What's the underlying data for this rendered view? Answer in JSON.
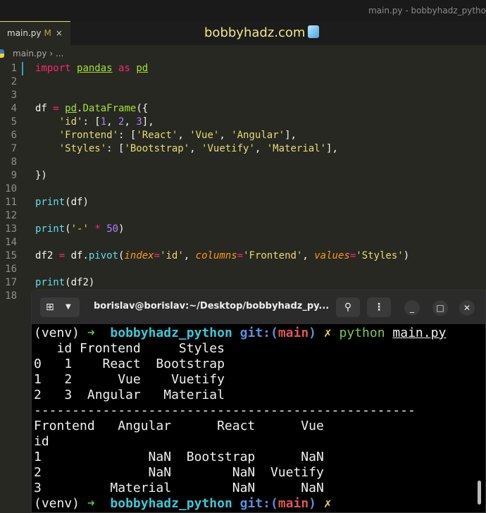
{
  "window_title": "main.py - bobbyhadz_pytho",
  "tab": {
    "label": "main.py",
    "modified": "M",
    "close": "×"
  },
  "brand": "bobbyhadz.com",
  "breadcrumb": {
    "file": "main.py",
    "sep": "›",
    "rest": "..."
  },
  "code": [
    [
      [
        "import",
        "k"
      ],
      [
        " ",
        ""
      ],
      [
        "pandas",
        "f u"
      ],
      [
        " ",
        ""
      ],
      [
        "as",
        "k"
      ],
      [
        " ",
        ""
      ],
      [
        "pd",
        "f u"
      ]
    ],
    [],
    [],
    [
      [
        "df ",
        ""
      ],
      [
        "=",
        "k"
      ],
      [
        " ",
        ""
      ],
      [
        "pd",
        "f u"
      ],
      [
        ".",
        ""
      ],
      [
        "DataFrame",
        "f"
      ],
      [
        "({",
        ""
      ]
    ],
    [
      [
        "    ",
        ""
      ],
      [
        "'id'",
        "s"
      ],
      [
        ": [",
        ""
      ],
      [
        "1",
        "n"
      ],
      [
        ", ",
        ""
      ],
      [
        "2",
        "n"
      ],
      [
        ", ",
        ""
      ],
      [
        "3",
        "n"
      ],
      [
        "],",
        ""
      ]
    ],
    [
      [
        "    ",
        ""
      ],
      [
        "'Frontend'",
        "s"
      ],
      [
        ": [",
        ""
      ],
      [
        "'React'",
        "s"
      ],
      [
        ", ",
        ""
      ],
      [
        "'Vue'",
        "s"
      ],
      [
        ", ",
        ""
      ],
      [
        "'Angular'",
        "s"
      ],
      [
        "],",
        ""
      ]
    ],
    [
      [
        "    ",
        ""
      ],
      [
        "'Styles'",
        "s"
      ],
      [
        ": [",
        ""
      ],
      [
        "'Bootstrap'",
        "s"
      ],
      [
        ", ",
        ""
      ],
      [
        "'Vuetify'",
        "s"
      ],
      [
        ", ",
        ""
      ],
      [
        "'Material'",
        "s"
      ],
      [
        "],",
        ""
      ]
    ],
    [],
    [
      [
        "})",
        ""
      ]
    ],
    [],
    [
      [
        "print",
        "b"
      ],
      [
        "(df)",
        ""
      ]
    ],
    [],
    [
      [
        "print",
        "b"
      ],
      [
        "(",
        ""
      ],
      [
        "'-'",
        "s"
      ],
      [
        " ",
        ""
      ],
      [
        "*",
        "k"
      ],
      [
        " ",
        ""
      ],
      [
        "50",
        "n"
      ],
      [
        ")",
        ""
      ]
    ],
    [],
    [
      [
        "df2 ",
        ""
      ],
      [
        "=",
        "k"
      ],
      [
        " df.",
        ""
      ],
      [
        "pivot",
        "b"
      ],
      [
        "(",
        ""
      ],
      [
        "index",
        "p"
      ],
      [
        "=",
        "k"
      ],
      [
        "'id'",
        "s"
      ],
      [
        ", ",
        ""
      ],
      [
        "columns",
        "p"
      ],
      [
        "=",
        "k"
      ],
      [
        "'Frontend'",
        "s"
      ],
      [
        ", ",
        ""
      ],
      [
        "values",
        "p"
      ],
      [
        "=",
        "k"
      ],
      [
        "'Styles'",
        "s"
      ],
      [
        ")",
        ""
      ]
    ],
    [],
    [
      [
        "print",
        "b"
      ],
      [
        "(df2)",
        ""
      ]
    ],
    []
  ],
  "terminal": {
    "title": "borislav@borislav:~/Desktop/bobbyhadz_py...",
    "lines": [
      [
        [
          "(venv) ",
          ""
        ],
        [
          "➜",
          "ar"
        ],
        [
          "  ",
          ""
        ],
        [
          "bobbyhadz_python",
          "cy"
        ],
        [
          " ",
          ""
        ],
        [
          "git:(",
          "bl"
        ],
        [
          "main",
          "rd"
        ],
        [
          ")",
          "bl"
        ],
        [
          " ",
          ""
        ],
        [
          "✗",
          "yl"
        ],
        [
          " ",
          ""
        ],
        [
          "python",
          "gr"
        ],
        [
          " ",
          ""
        ],
        [
          "main.py",
          "ul"
        ]
      ],
      [
        [
          "   id Frontend     Styles",
          ""
        ]
      ],
      [
        [
          "0   1    React  Bootstrap",
          ""
        ]
      ],
      [
        [
          "1   2      Vue    Vuetify",
          ""
        ]
      ],
      [
        [
          "2   3  Angular   Material",
          ""
        ]
      ],
      [
        [
          "--------------------------------------------------",
          ""
        ]
      ],
      [
        [
          "Frontend   Angular      React      Vue",
          ""
        ]
      ],
      [
        [
          "id",
          ""
        ]
      ],
      [
        [
          "1              NaN  Bootstrap      NaN",
          ""
        ]
      ],
      [
        [
          "2              NaN        NaN  Vuetify",
          ""
        ]
      ],
      [
        [
          "3         Material        NaN      NaN",
          ""
        ]
      ],
      [
        [
          "(venv) ",
          ""
        ],
        [
          "➜",
          "ar"
        ],
        [
          "  ",
          ""
        ],
        [
          "bobbyhadz_python",
          "cy"
        ],
        [
          " ",
          ""
        ],
        [
          "git:(",
          "bl"
        ],
        [
          "main",
          "rd"
        ],
        [
          ")",
          "bl"
        ],
        [
          " ",
          ""
        ],
        [
          "✗",
          "yl"
        ]
      ]
    ]
  }
}
